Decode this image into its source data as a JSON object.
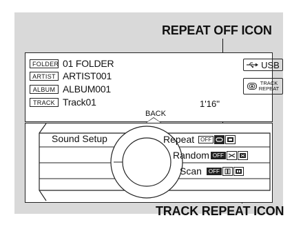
{
  "callouts": {
    "repeat_off_icon": "REPEAT OFF ICON",
    "track_repeat_icon": "TRACK REPEAT ICON"
  },
  "display": {
    "rows": [
      {
        "tag": "FOLDER",
        "value": "01 FOLDER"
      },
      {
        "tag": "ARTIST",
        "value": "ARTIST001"
      },
      {
        "tag": "ALBUM",
        "value": "ALBUM001"
      },
      {
        "tag": "TRACK",
        "value": "Track01"
      }
    ],
    "elapsed_time": "1'16''",
    "source_label": "USB",
    "track_repeat_label": "TRACK\nREPEAT",
    "back_label": "BACK"
  },
  "console": {
    "sound_setup_label": "Sound Setup",
    "repeat_label": "Repeat",
    "random_label": "Random",
    "scan_label": "Scan",
    "off_chip_label": "OFF"
  },
  "colors": {
    "panel_bg": "#d9d9d9",
    "line": "#222222",
    "screen": "#ffffff"
  },
  "icons": [
    "usb-icon",
    "track-repeat-icon",
    "repeat-off-icon",
    "track-repeat-option-icon",
    "folder-repeat-option-icon",
    "back-arrow-icon"
  ]
}
